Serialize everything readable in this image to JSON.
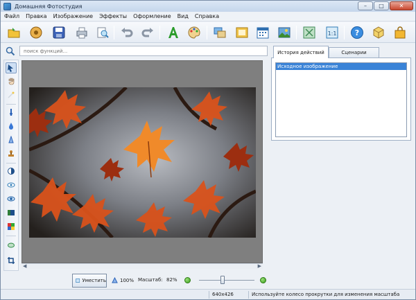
{
  "window": {
    "title": "Домашняя Фотостудия",
    "controls": [
      "–",
      "□",
      "✕"
    ]
  },
  "menu": [
    "Файл",
    "Правка",
    "Изображение",
    "Эффекты",
    "Оформление",
    "Вид",
    "Справка"
  ],
  "toolbar": {
    "icons": [
      "open-folder-icon",
      "camera-roll-icon",
      "save-icon",
      "print-icon",
      "print-preview-icon",
      "undo-icon",
      "redo-icon",
      "text-icon",
      "palette-icon",
      "collage-icon",
      "frame-icon",
      "calendar-icon",
      "postcard-icon",
      "fullscreen-icon",
      "actual-size-icon",
      "help-icon",
      "cube-icon",
      "shopping-bag-icon"
    ]
  },
  "search": {
    "placeholder": "поиск функций..."
  },
  "tools": [
    "pointer-icon",
    "hand-icon",
    "magic-wand-icon",
    "brush-icon",
    "blur-drop-icon",
    "sharpen-icon",
    "stamp-icon",
    "contrast-icon",
    "redeye-icon",
    "eye-icon",
    "layers-icon",
    "color-pick-icon",
    "rotate-icon",
    "crop-icon"
  ],
  "panel": {
    "tabs": [
      {
        "label": "История действий",
        "active": true
      },
      {
        "label": "Сценарии",
        "active": false
      }
    ],
    "history": [
      "Исходное изображение"
    ]
  },
  "zoom": {
    "fit_label": "Уместить",
    "actual_label": "100%",
    "scale_label": "Масштаб:",
    "scale_value": "82%",
    "slider_level": 0.38
  },
  "status": {
    "size": "640x426",
    "hint": "Используйте колесо прокрутки для изменения масштаба"
  },
  "colors": {
    "accent": "#3a83d7",
    "canvas": "#7f7f7f",
    "window": "#ecf0f5"
  }
}
